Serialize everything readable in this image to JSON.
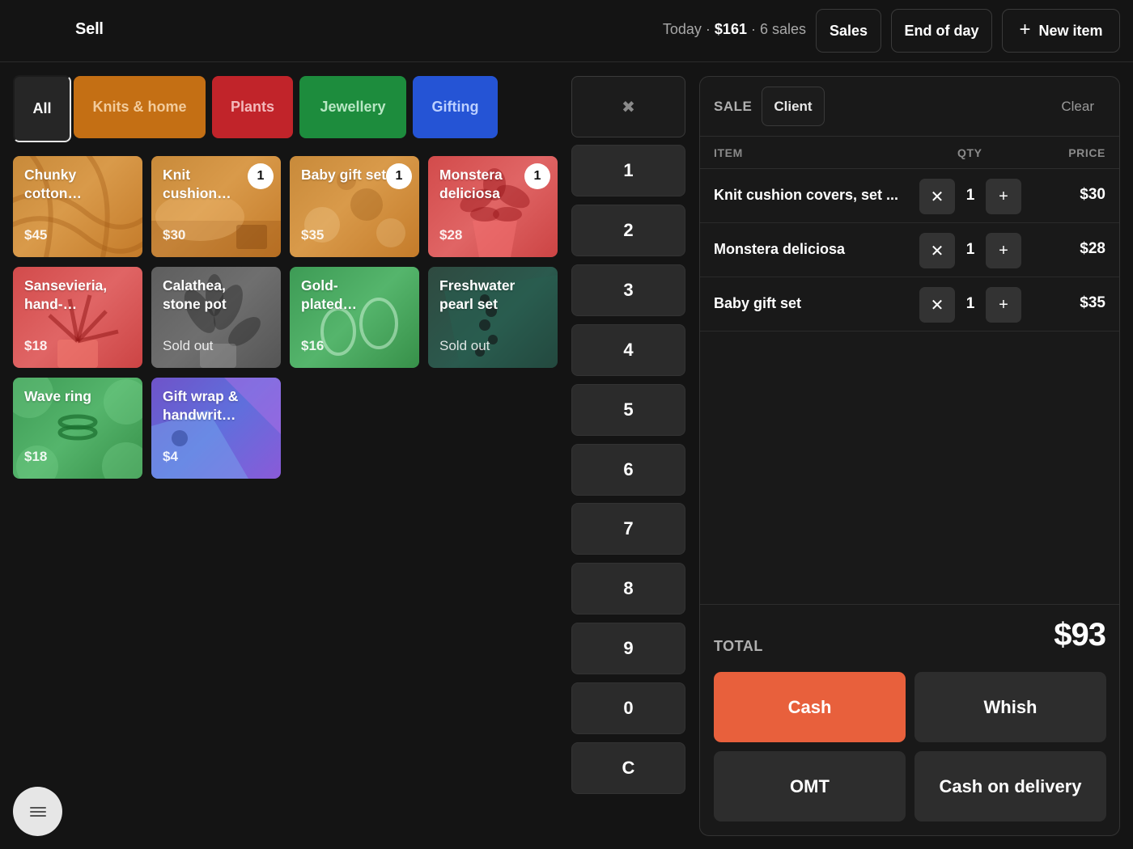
{
  "header": {
    "title": "Sell",
    "summary_prefix": "Today · ",
    "summary_amount": "$161",
    "summary_suffix": " · 6 sales",
    "sales_label": "Sales",
    "end_of_day_label": "End of day",
    "new_item_label": "New item"
  },
  "categories": [
    {
      "label": "All",
      "selected": true
    },
    {
      "label": "Knits & home",
      "color": "#c46f14"
    },
    {
      "label": "Plants",
      "color": "#c1242a"
    },
    {
      "label": "Jewellery",
      "color": "#1d8c3d"
    },
    {
      "label": "Gifting",
      "color": "#2554d5"
    }
  ],
  "products": [
    {
      "name": "Chunky cotton…",
      "price": "$45",
      "badge": ""
    },
    {
      "name": "Knit cushion…",
      "price": "$30",
      "badge": "1"
    },
    {
      "name": "Baby gift set",
      "price": "$35",
      "badge": "1"
    },
    {
      "name": "Monstera deliciosa",
      "price": "$28",
      "badge": "1"
    },
    {
      "name": "Sansevieria, hand-…",
      "price": "$18",
      "badge": ""
    },
    {
      "name": "Calathea, stone pot",
      "price": "Sold out",
      "badge": ""
    },
    {
      "name": "Gold-plated…",
      "price": "$16",
      "badge": ""
    },
    {
      "name": "Freshwater pearl set",
      "price": "Sold out",
      "badge": ""
    },
    {
      "name": "Wave ring",
      "price": "$18",
      "badge": ""
    },
    {
      "name": "Gift wrap & handwrit…",
      "price": "$4",
      "badge": ""
    }
  ],
  "keypad": {
    "backspace": "✖",
    "keys": [
      "1",
      "2",
      "3",
      "4",
      "5",
      "6",
      "7",
      "8",
      "9",
      "0",
      "C"
    ]
  },
  "sale": {
    "label": "SALE",
    "client_label": "Client",
    "clear_label": "Clear",
    "col_item": "ITEM",
    "col_qty": "QTY",
    "col_price": "PRICE",
    "lines": [
      {
        "name": "Knit cushion covers, set ...",
        "qty": "1",
        "price": "$30"
      },
      {
        "name": "Monstera deliciosa",
        "qty": "1",
        "price": "$28"
      },
      {
        "name": "Baby gift set",
        "qty": "1",
        "price": "$35"
      }
    ],
    "total_label": "TOTAL",
    "total": "$93"
  },
  "payments": {
    "cash": "Cash",
    "whish": "Whish",
    "omt": "OMT",
    "cod": "Cash on delivery",
    "cash_color": "#e8603c"
  }
}
